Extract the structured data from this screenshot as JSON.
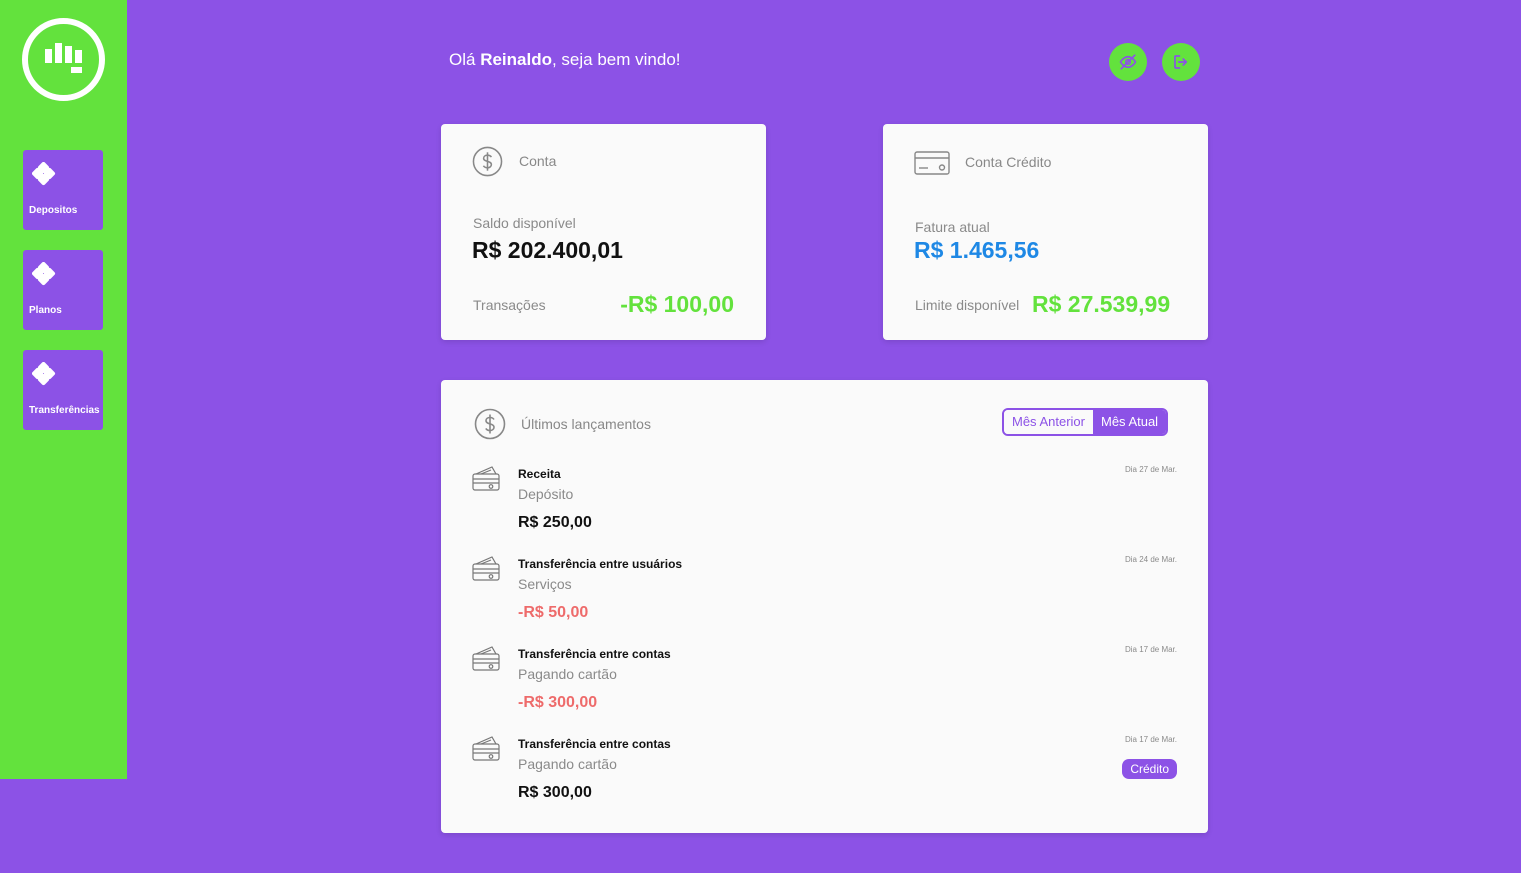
{
  "sidebar": {
    "items": [
      {
        "label": "Depositos"
      },
      {
        "label": "Planos"
      },
      {
        "label": "Transferências"
      }
    ]
  },
  "header": {
    "greeting_prefix": "Olá ",
    "user_name": "Reinaldo",
    "greeting_suffix": ", seja bem vindo!",
    "buttons": [
      "eye-off-icon",
      "logout-icon"
    ]
  },
  "account_card": {
    "title": "Conta",
    "balance_label": "Saldo disponível",
    "balance_value": "R$ 202.400,01",
    "transactions_label": "Transações",
    "transactions_value": "-R$ 100,00"
  },
  "credit_card": {
    "title": "Conta Crédito",
    "invoice_label": "Fatura atual",
    "invoice_value": "R$ 1.465,56",
    "limit_label": "Limite disponível",
    "limit_value": "R$ 27.539,99"
  },
  "entries": {
    "title": "Últimos lançamentos",
    "toggle": {
      "previous": "Mês Anterior",
      "current": "Mês Atual"
    },
    "items": [
      {
        "title": "Receita",
        "category": "Depósito",
        "value": "R$ 250,00",
        "date": "Dia 27 de Mar.",
        "negative": false,
        "badge": ""
      },
      {
        "title": "Transferência entre usuários",
        "category": "Serviços",
        "value": "-R$ 50,00",
        "date": "Dia 24 de Mar.",
        "negative": true,
        "badge": ""
      },
      {
        "title": "Transferência entre contas",
        "category": "Pagando cartão",
        "value": "-R$ 300,00",
        "date": "Dia 17 de Mar.",
        "negative": true,
        "badge": ""
      },
      {
        "title": "Transferência entre contas",
        "category": "Pagando cartão",
        "value": "R$ 300,00",
        "date": "Dia 17 de Mar.",
        "negative": false,
        "badge": "Crédito"
      }
    ]
  },
  "colors": {
    "purple": "#8c52e6",
    "green": "#63e23d",
    "blue": "#1e88e5",
    "negative": "#ee6b6b"
  }
}
